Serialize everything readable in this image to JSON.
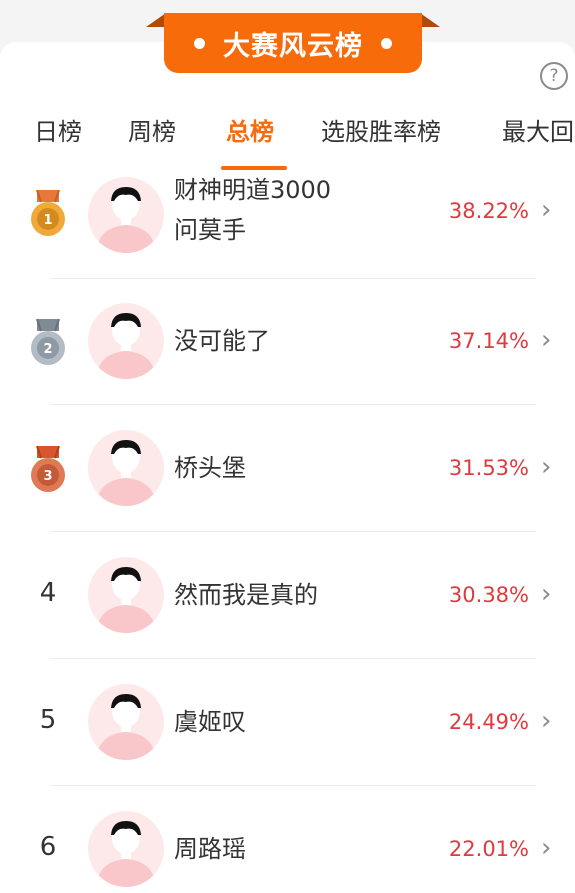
{
  "banner": {
    "title": "大赛风云榜"
  },
  "help_icon": "?",
  "tabs": [
    {
      "label": "日榜"
    },
    {
      "label": "周榜"
    },
    {
      "label": "总榜"
    },
    {
      "label": "选股胜率榜"
    },
    {
      "label": "最大回"
    }
  ],
  "active_tab": "总榜",
  "rows": [
    {
      "rank": "1",
      "name_line1": "财神明道3000",
      "name_line2": "问莫手",
      "pct": "38.22%"
    },
    {
      "rank": "2",
      "name": "没可能了",
      "pct": "37.14%"
    },
    {
      "rank": "3",
      "name": "桥头堡",
      "pct": "31.53%"
    },
    {
      "rank": "4",
      "name": "然而我是真的",
      "pct": "30.38%"
    },
    {
      "rank": "5",
      "name": "虞姬叹",
      "pct": "24.49%"
    },
    {
      "rank": "6",
      "name": "周路瑶",
      "pct": "22.01%"
    }
  ],
  "colors": {
    "accent": "#f76b0a",
    "percent": "#e0393e",
    "gold": "#f0a93a",
    "silver": "#9aa4ae",
    "bronze": "#d9704f"
  }
}
